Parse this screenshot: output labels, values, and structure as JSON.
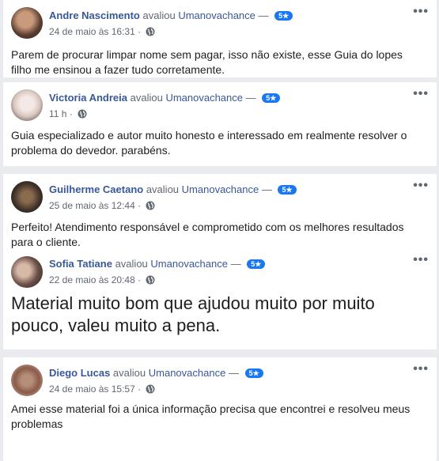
{
  "common": {
    "verb": "avaliou",
    "page_name": "Umanovachance",
    "dash": "—",
    "rating": "5★",
    "more": "•••"
  },
  "reviews": [
    {
      "author": "Andre Nascimento",
      "time": "24 de maio às 16:31",
      "text": "Parem de procurar limpar nome sem pagar, isso não existe, esse Guia do lopes filho me ensinou a fazer tudo corretamente."
    },
    {
      "author": "Victoria Andreia",
      "time": "11 h",
      "text": "Guia especializado e autor muito honesto e interessado em realmente resolver o problema do devedor. parabéns."
    },
    {
      "author": "Guilherme Caetano",
      "time": "25 de maio às 12:44",
      "text": "Perfeito! Atendimento responsável e comprometido com os melhores resultados para o cliente."
    },
    {
      "author": "Sofia Tatiane",
      "time": "22 de maio às 20:48",
      "text": "Material muito bom que ajudou muito por muito pouco, valeu muito a pena."
    },
    {
      "author": "Diego Lucas",
      "time": "24 de maio às 15:57",
      "text": "Amei esse material foi a única informação precisa que encontrei e resolveu meus problemas"
    }
  ],
  "colors": {
    "link": "#385898",
    "badge": "#1877f2",
    "background": "#e9ebee"
  }
}
